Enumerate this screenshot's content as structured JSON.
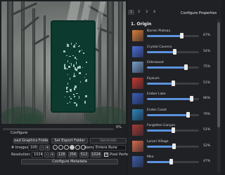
{
  "progress": {
    "value_text": "0%",
    "fraction": 0.0
  },
  "config": {
    "title": "Configure",
    "load_button": "Load Graphics Folder",
    "export_button": "Set Export Folder",
    "generate_button": "Generate",
    "images_label": "# Images:",
    "images_value": "100",
    "images_minus": "-",
    "images_plus": "+",
    "name_label": "Name:",
    "name_value": "Entera Rune",
    "resolution_label": "Resolution:",
    "resolution_value": "1024",
    "res_minus": "-",
    "res_plus": "+",
    "presets": [
      "128",
      "256",
      "512",
      "1024"
    ],
    "pixel_perfect_label": "Pixel Perfect",
    "pixel_perfect_checked": true,
    "metadata_button": "Configure Metadata",
    "radio_count": 6,
    "radio_selected": 3
  },
  "properties": {
    "title": "Configure Properties",
    "tabs": [
      "1",
      "2",
      "3",
      "4"
    ],
    "active_tab": 0,
    "section_title": "1. Origin",
    "items": [
      {
        "name": "Barren Plateau",
        "value": 0.67,
        "pct_text": "67%",
        "thumb": "#d9803b"
      },
      {
        "name": "Crystal Caverns",
        "value": 0.54,
        "pct_text": "54%",
        "thumb": "#4a6fd6"
      },
      {
        "name": "Elderwood",
        "value": 0.75,
        "pct_text": "75%",
        "thumb": "#7aa1c9"
      },
      {
        "name": "Elysium",
        "value": 0.51,
        "pct_text": "51%",
        "thumb": "#c23b2e"
      },
      {
        "name": "Ember Lake",
        "value": 0.86,
        "pct_text": "86%",
        "thumb": "#3b5fb8"
      },
      {
        "name": "Endos Coast",
        "value": 0.79,
        "pct_text": "79%",
        "thumb": "#2f86b8"
      },
      {
        "name": "Forgotten Canyon",
        "value": 0.51,
        "pct_text": "51%",
        "thumb": "#a33d35"
      },
      {
        "name": "Lunari Village",
        "value": 0.52,
        "pct_text": "52%",
        "thumb": "#d56c4a"
      },
      {
        "name": "Mire",
        "value": 0.47,
        "pct_text": "47%",
        "thumb": "#3f5ea5"
      }
    ]
  }
}
